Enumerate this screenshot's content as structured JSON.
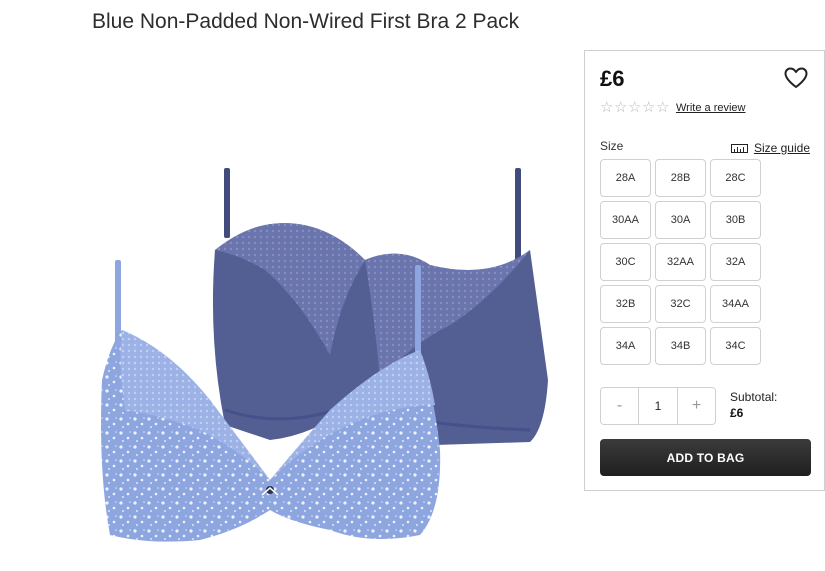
{
  "product": {
    "title": "Blue Non-Padded Non-Wired First Bra 2 Pack",
    "image_alt_icon": "product-photo-bra-2-pack",
    "colors": {
      "navy": "#535e92",
      "navy_dark": "#3e4878",
      "light_blue": "#8ea6df",
      "lace": "#6e78b0"
    }
  },
  "purchase_panel": {
    "price": "£6",
    "wishlist_icon": "heart-outline-icon",
    "rating": {
      "stars_filled": 0,
      "stars_total": 5
    },
    "review_link": "Write a review",
    "size_label": "Size",
    "size_guide_label": "Size guide",
    "sizes": [
      "28A",
      "28B",
      "28C",
      "30AA",
      "30A",
      "30B",
      "30C",
      "32AA",
      "32A",
      "32B",
      "32C",
      "34AA",
      "34A",
      "34B",
      "34C"
    ],
    "quantity": {
      "minus": "-",
      "value": "1",
      "plus": "+"
    },
    "subtotal_label": "Subtotal:",
    "subtotal_value": "£6",
    "add_to_bag_label": "ADD TO BAG",
    "button_color": "#2a2a2a"
  }
}
